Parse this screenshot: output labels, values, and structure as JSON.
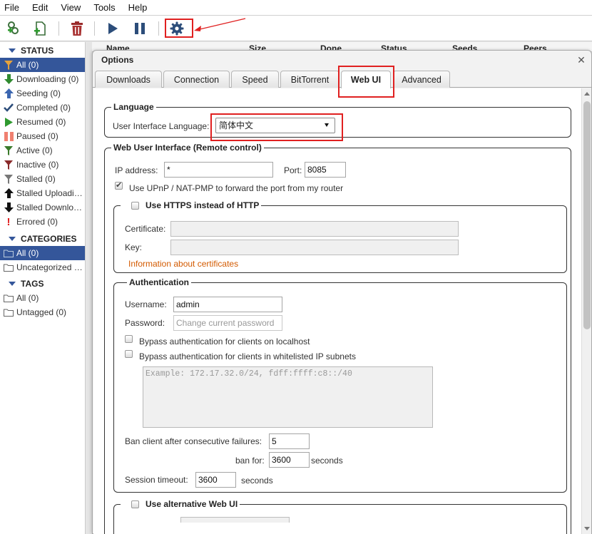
{
  "menu": [
    "File",
    "Edit",
    "View",
    "Tools",
    "Help"
  ],
  "toolbar": {
    "icons": [
      "add-link-icon",
      "add-file-icon",
      "delete-icon",
      "resume-icon",
      "pause-icon",
      "options-gear-icon"
    ]
  },
  "sidebar": {
    "status_header": "STATUS",
    "status_items": [
      {
        "label": "All (0)",
        "icon": "filter-icon",
        "selected": true
      },
      {
        "label": "Downloading (0)",
        "icon": "download-arrow-icon"
      },
      {
        "label": "Seeding (0)",
        "icon": "upload-arrow-icon"
      },
      {
        "label": "Completed (0)",
        "icon": "checkmark-icon"
      },
      {
        "label": "Resumed (0)",
        "icon": "play-icon"
      },
      {
        "label": "Paused (0)",
        "icon": "pause-icon"
      },
      {
        "label": "Active (0)",
        "icon": "filter-icon"
      },
      {
        "label": "Inactive (0)",
        "icon": "filter-icon"
      },
      {
        "label": "Stalled (0)",
        "icon": "filter-icon"
      },
      {
        "label": "Stalled Uploadi…",
        "icon": "up-arrow-icon"
      },
      {
        "label": "Stalled Downlo…",
        "icon": "down-arrow-icon"
      },
      {
        "label": "Errored (0)",
        "icon": "error-icon"
      }
    ],
    "categories_header": "CATEGORIES",
    "category_items": [
      {
        "label": "All (0)",
        "selected": true
      },
      {
        "label": "Uncategorized …"
      }
    ],
    "tags_header": "TAGS",
    "tag_items": [
      {
        "label": "All (0)"
      },
      {
        "label": "Untagged (0)"
      }
    ]
  },
  "torrent_list": {
    "columns": [
      "Name",
      "Size",
      "Done",
      "Status",
      "Seeds",
      "Peers"
    ]
  },
  "options": {
    "title": "Options",
    "tabs": [
      "Downloads",
      "Connection",
      "Speed",
      "BitTorrent",
      "Web UI",
      "Advanced"
    ],
    "active_tab": "Web UI",
    "language": {
      "legend": "Language",
      "label": "User Interface Language:",
      "value": "简体中文"
    },
    "webui": {
      "legend": "Web User Interface (Remote control)",
      "ip_label": "IP address:",
      "ip_value": "*",
      "port_label": "Port:",
      "port_value": "8085",
      "upnp_label": "Use UPnP / NAT-PMP to forward the port from my router",
      "upnp_checked": true
    },
    "https": {
      "legend": "Use HTTPS instead of HTTP",
      "checked": false,
      "certificate_label": "Certificate:",
      "key_label": "Key:",
      "info_link": "Information about certificates"
    },
    "auth": {
      "legend": "Authentication",
      "username_label": "Username:",
      "username_value": "admin",
      "password_label": "Password:",
      "password_placeholder": "Change current password",
      "bypass_localhost": "Bypass authentication for clients on localhost",
      "bypass_whitelist": "Bypass authentication for clients in whitelisted IP subnets",
      "whitelist_placeholder": "Example: 172.17.32.0/24, fdff:ffff:c8::/40",
      "ban_label": "Ban client after consecutive failures:",
      "ban_value": "5",
      "ban_for_label": "ban for:",
      "ban_for_value": "3600",
      "seconds": "seconds",
      "session_label": "Session timeout:",
      "session_value": "3600"
    },
    "alt_webui": {
      "legend": "Use alternative Web UI",
      "checked": false
    }
  },
  "colors": {
    "selection": "#34569a",
    "highlight_box": "#e02020",
    "link": "#d35a00"
  }
}
